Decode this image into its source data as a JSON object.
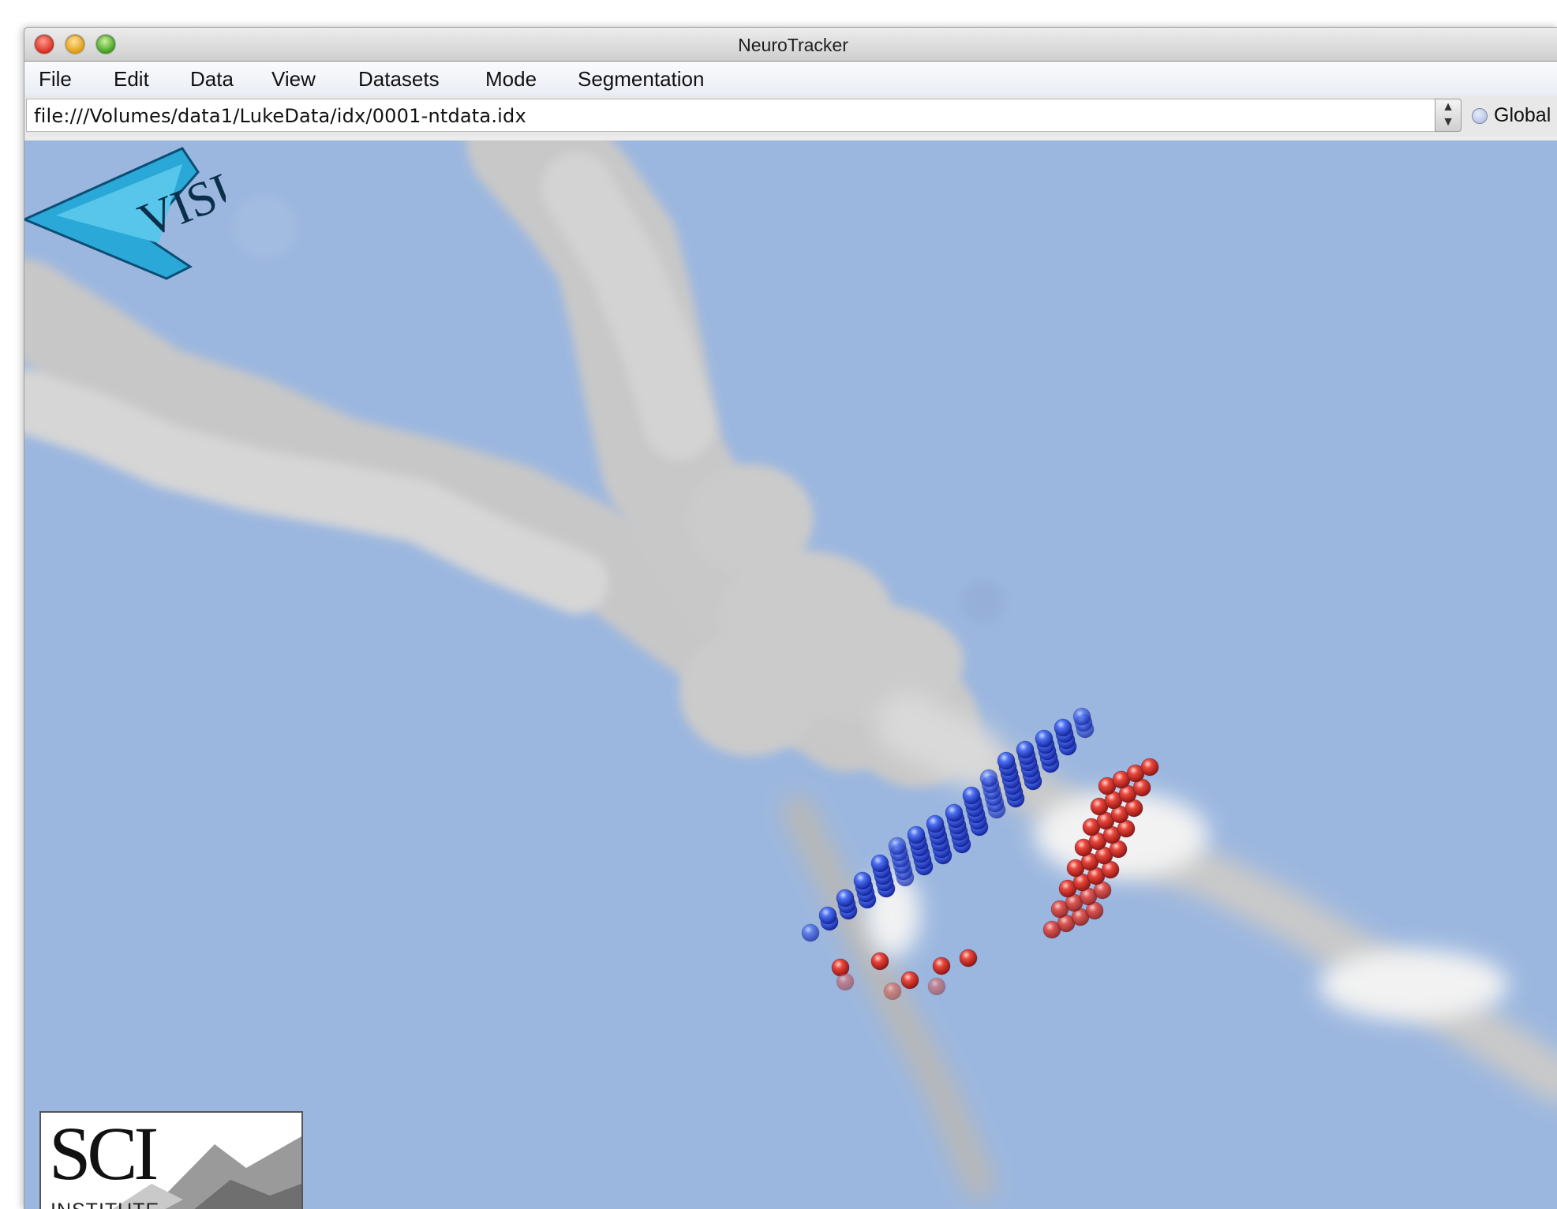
{
  "window": {
    "title": "NeuroTracker"
  },
  "menubar": {
    "items": [
      "File",
      "Edit",
      "Data",
      "View",
      "Datasets",
      "Mode",
      "Segmentation"
    ]
  },
  "urlbar": {
    "value": "file:///Volumes/data1/LukeData/idx/0001-ntdata.idx"
  },
  "view_toggle": {
    "label": "Global",
    "selected": false
  },
  "logos": {
    "sci": {
      "main": "SCI",
      "sub": "INSTITUTE"
    },
    "visus": {
      "text": "VISUS"
    }
  },
  "colors": {
    "viewport_background": "#9cb7df",
    "blue_markers": "#2b4fd8",
    "red_markers": "#d8302a",
    "neuron_gray": "#cfcfcf"
  },
  "icons": [
    "window-close-icon",
    "window-minimize-icon",
    "window-zoom-icon",
    "url-stepper-icon",
    "radio-icon"
  ]
}
